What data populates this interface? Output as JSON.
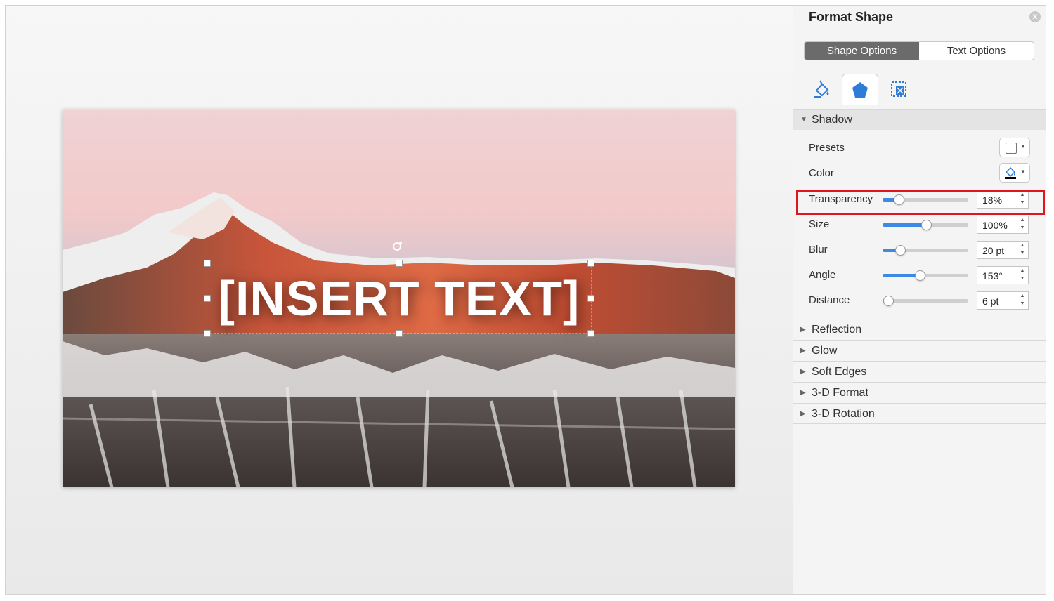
{
  "slide": {
    "text": "[INSERT TEXT]"
  },
  "panel": {
    "title": "Format Shape",
    "tabs": [
      "Shape Options",
      "Text Options"
    ],
    "active_tab": "Shape Options",
    "icon_tabs": [
      "fill-line-icon",
      "effects-icon",
      "size-properties-icon"
    ],
    "active_icon_tab": "effects-icon",
    "shadow": {
      "header": "Shadow",
      "presets_label": "Presets",
      "color_label": "Color",
      "rows": [
        {
          "label": "Transparency",
          "value": "18%",
          "level": 0.18
        },
        {
          "label": "Size",
          "value": "100%",
          "level": 0.5
        },
        {
          "label": "Blur",
          "value": "20 pt",
          "level": 0.2
        },
        {
          "label": "Angle",
          "value": "153°",
          "level": 0.425
        },
        {
          "label": "Distance",
          "value": "6 pt",
          "level": 0.06
        }
      ]
    },
    "collapsed_sections": [
      "Reflection",
      "Glow",
      "Soft Edges",
      "3-D Format",
      "3-D Rotation"
    ]
  },
  "colors": {
    "accent": "#3d8ae5",
    "highlight": "#e3141b",
    "shadow_color": "#000000"
  }
}
